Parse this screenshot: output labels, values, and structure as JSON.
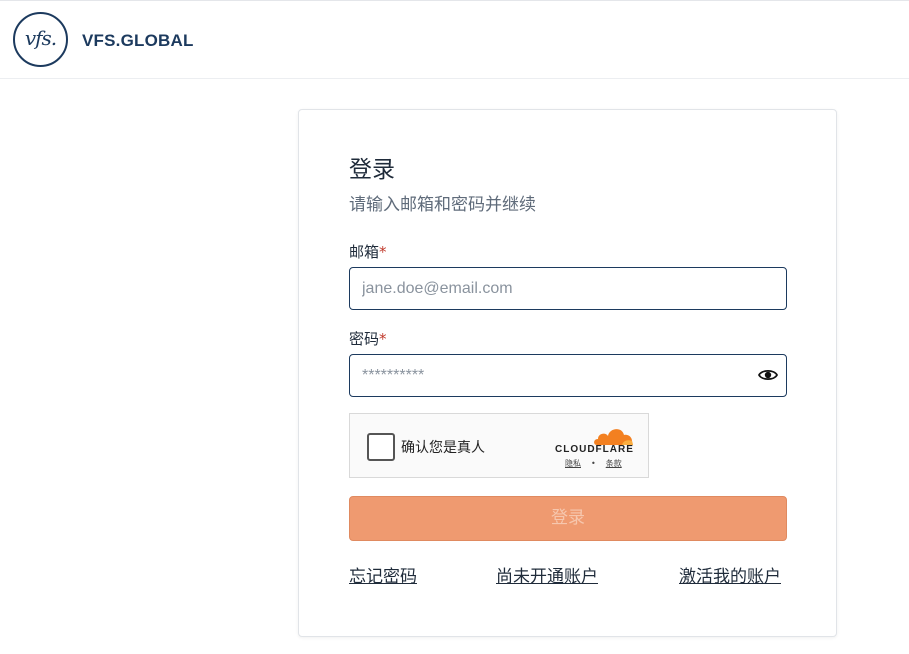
{
  "header": {
    "logo_mark": "vfs.",
    "logo_text": "VFS.GLOBAL"
  },
  "login": {
    "title": "登录",
    "subtitle": "请输入邮箱和密码并继续",
    "email_label": "邮箱",
    "email_placeholder": "jane.doe@email.com",
    "email_value": "",
    "password_label": "密码",
    "password_placeholder": "**********",
    "password_value": "",
    "required_marker": "*",
    "submit_label": "登录"
  },
  "captcha": {
    "label": "确认您是真人",
    "brand": "CLOUDFLARE",
    "privacy_link": "隐私",
    "separator": "•",
    "terms_link": "条款",
    "checked": false
  },
  "links": {
    "forgot_password": "忘记密码",
    "no_account": "尚未开通账户",
    "activate_account": "激活我的账户"
  },
  "colors": {
    "brand_navy": "#1c3a5e",
    "submit_bg": "#ef9a70",
    "required": "#c0392b",
    "cloudflare_orange": "#f38020"
  },
  "icons": {
    "password_toggle": "eye-icon",
    "cloudflare": "cloud-icon"
  }
}
